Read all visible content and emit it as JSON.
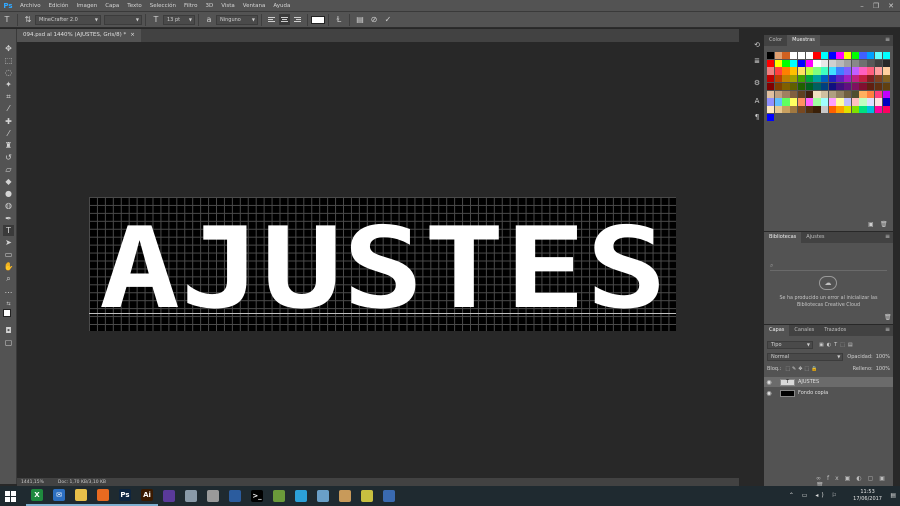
{
  "app": {
    "logo": "Ps"
  },
  "menu": [
    "Archivo",
    "Edición",
    "Imagen",
    "Capa",
    "Texto",
    "Selección",
    "Filtro",
    "3D",
    "Vista",
    "Ventana",
    "Ayuda"
  ],
  "window_controls": {
    "minimize": "–",
    "restore": "❐",
    "close": "✕"
  },
  "options": {
    "font_family": "MineCrafter 2.0",
    "font_size": "13 pt",
    "antialias": "Ninguno",
    "text_color": "#ffffff"
  },
  "document": {
    "tab_title": "094.psd al 1440% (AJUSTES, Gris/8) *",
    "close_symbol": "×",
    "canvas_text": "AJUSTES",
    "zoom": "1441,15%",
    "doc_size": "Doc: 1,70 KB/3,10 KB"
  },
  "swatches_panel": {
    "tabs": [
      "Color",
      "Muestras"
    ],
    "active_tab": "Muestras",
    "colors": [
      "#000000",
      "#e0a070",
      "#d06020",
      "#ffffff",
      "#ffffff",
      "#ffffff",
      "#ff0000",
      "#00ffff",
      "#0000ff",
      "#ff00ff",
      "#ffff00",
      "#00ff00",
      "#4060ff",
      "#00a0ff",
      "#60ffff",
      "#00ffff",
      "#ff0000",
      "#ffff00",
      "#00ff00",
      "#00ffff",
      "#0000ff",
      "#ff00ff",
      "#ffffff",
      "#e8e8e8",
      "#d0d0d0",
      "#b8b8b8",
      "#a0a0a0",
      "#888888",
      "#707070",
      "#585858",
      "#404040",
      "#282828",
      "#f08080",
      "#ff4040",
      "#ff8000",
      "#ffc000",
      "#ffe060",
      "#c0ff40",
      "#80ff80",
      "#40ffc0",
      "#40e0ff",
      "#4080ff",
      "#8060ff",
      "#c060ff",
      "#ff60c0",
      "#ff6080",
      "#ffa0a0",
      "#ffd0a0",
      "#c00000",
      "#c04000",
      "#c08000",
      "#a0a000",
      "#40a000",
      "#00a040",
      "#00a0a0",
      "#0060c0",
      "#2020c0",
      "#6020c0",
      "#a020c0",
      "#c02080",
      "#c02040",
      "#802020",
      "#804020",
      "#806020",
      "#800000",
      "#804000",
      "#806000",
      "#606000",
      "#206000",
      "#006020",
      "#006060",
      "#004080",
      "#101080",
      "#401080",
      "#601080",
      "#801060",
      "#801030",
      "#602010",
      "#603010",
      "#604010",
      "#e0c0a0",
      "#c0a080",
      "#a08060",
      "#806040",
      "#604020",
      "#402010",
      "#f0e0c0",
      "#d0c0a0",
      "#b0a080",
      "#908060",
      "#706040",
      "#505030",
      "#ffb060",
      "#ff8040",
      "#ff4080",
      "#c000ff",
      "#9090ff",
      "#60c0ff",
      "#60ff60",
      "#ffff60",
      "#ff9060",
      "#ff60ff",
      "#a0ffa0",
      "#a0ffff",
      "#ffa0ff",
      "#ffffa0",
      "#c0c0ff",
      "#ffc0c0",
      "#c0ffc0",
      "#e0e0ff",
      "#ffe0e0",
      "#0000c0",
      "#ffe8c0",
      "#e8c890",
      "#c8a060",
      "#a07840",
      "#784820",
      "#503010",
      "#3a2008",
      "#c8c8c8",
      "#ff6000",
      "#ffa000",
      "#e0e000",
      "#80e000",
      "#00e080",
      "#00c0e0",
      "#ff00a0",
      "#ff0060"
    ]
  },
  "libraries_panel": {
    "tabs": [
      "Bibliotecas",
      "Ajustes"
    ],
    "active_tab": "Bibliotecas",
    "message": "Se ha producido un error al inicializar las Bibliotecas Creative Cloud"
  },
  "layers_panel": {
    "tabs": [
      "Capas",
      "Canales",
      "Trazados"
    ],
    "active_tab": "Capas",
    "filter_label": "Tipo",
    "blend_mode": "Normal",
    "opacity_label": "Opacidad:",
    "opacity_value": "100%",
    "lock_label": "Bloq.:",
    "fill_label": "Relleno:",
    "fill_value": "100%",
    "layers": [
      {
        "name": "AJUSTES",
        "kind": "T",
        "selected": true
      },
      {
        "name": "Fondo copia",
        "kind": "",
        "selected": false
      }
    ]
  },
  "taskbar": {
    "time": "11:53",
    "date": "17/06/2017",
    "apps": [
      {
        "name": "excel",
        "color": "#1e8a3e",
        "glyph": "X"
      },
      {
        "name": "mail",
        "color": "#2c6fc0",
        "glyph": "✉"
      },
      {
        "name": "explorer",
        "color": "#e8c04a",
        "glyph": ""
      },
      {
        "name": "firefox",
        "color": "#e86a20",
        "glyph": ""
      },
      {
        "name": "photoshop",
        "color": "#0e2540",
        "glyph": "Ps"
      },
      {
        "name": "illustrator",
        "color": "#3a1a00",
        "glyph": "Ai"
      },
      {
        "name": "visual-studio",
        "color": "#5a3a9a",
        "glyph": ""
      },
      {
        "name": "clock-app",
        "color": "#8a9aa8",
        "glyph": ""
      },
      {
        "name": "media",
        "color": "#9a9a9a",
        "glyph": ""
      },
      {
        "name": "word-doc",
        "color": "#2b5c9e",
        "glyph": ""
      },
      {
        "name": "terminal",
        "color": "#000000",
        "glyph": ">_"
      },
      {
        "name": "minecraft",
        "color": "#6a9a3a",
        "glyph": ""
      },
      {
        "name": "telegram",
        "color": "#2ca0d8",
        "glyph": ""
      },
      {
        "name": "notepad",
        "color": "#6aa0c8",
        "glyph": ""
      },
      {
        "name": "gallery",
        "color": "#c89a5a",
        "glyph": ""
      },
      {
        "name": "folder-yellow",
        "color": "#c8c040",
        "glyph": ""
      },
      {
        "name": "virtualbox",
        "color": "#3a6ab0",
        "glyph": ""
      }
    ]
  }
}
